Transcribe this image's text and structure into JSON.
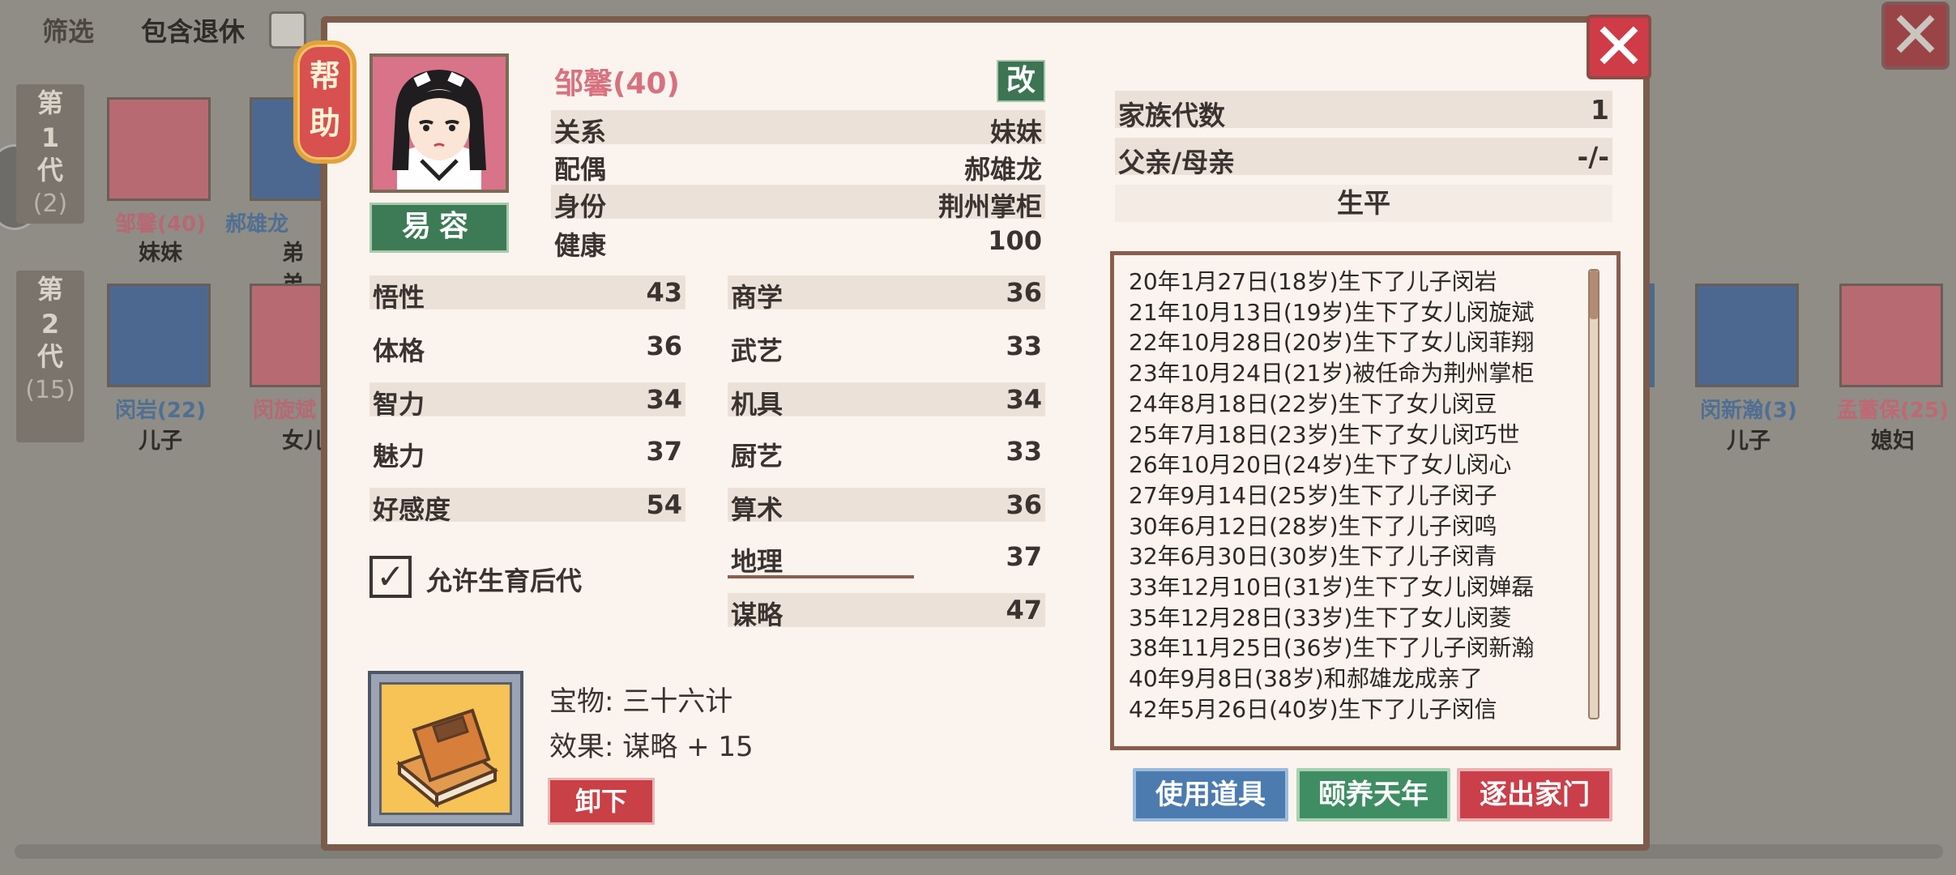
{
  "background": {
    "filter_label": "筛选",
    "include_retired_label": "包含退休",
    "generations": [
      {
        "label": "第\n1\n代",
        "line1": "第",
        "line2": "1",
        "line3": "代",
        "count": "(2)"
      },
      {
        "label": "第\n2\n代",
        "line1": "第",
        "line2": "2",
        "line3": "代",
        "count": "(15)"
      }
    ],
    "members_row1": [
      {
        "name": "邹馨(40)",
        "relation": "妹妹",
        "color": "#c06873"
      },
      {
        "name": "郝雄龙",
        "relation": "弟弟",
        "color": "#4f6f93"
      }
    ],
    "members_row2": [
      {
        "name": "闵岩(22)",
        "relation": "儿子",
        "color": "#4f6f93"
      },
      {
        "name": "闵旋斌",
        "relation": "女儿",
        "color": "#c06873"
      },
      {
        "name": "闵新瀚(3)",
        "relation": "儿子",
        "color": "#4f6f93"
      },
      {
        "name": "孟蓄保(25)",
        "relation": "媳妇",
        "color": "#c06873"
      }
    ]
  },
  "dialog": {
    "help_label_1": "帮",
    "help_label_2": "助",
    "close_icon": "close-icon",
    "name": "邹馨(40)",
    "edit_label": "改",
    "disguise_label": "易容",
    "info": [
      {
        "key": "关系",
        "value": "妹妹"
      },
      {
        "key": "配偶",
        "value": "郝雄龙"
      },
      {
        "key": "身份",
        "value": "荆州掌柜"
      },
      {
        "key": "健康",
        "value": "100"
      }
    ],
    "stats_left": [
      {
        "key": "悟性",
        "value": "43"
      },
      {
        "key": "体格",
        "value": "36"
      },
      {
        "key": "智力",
        "value": "34"
      },
      {
        "key": "魅力",
        "value": "37"
      },
      {
        "key": "好感度",
        "value": "54"
      }
    ],
    "stats_right": [
      {
        "key": "商学",
        "value": "36"
      },
      {
        "key": "武艺",
        "value": "33"
      },
      {
        "key": "机具",
        "value": "34"
      },
      {
        "key": "厨艺",
        "value": "33"
      },
      {
        "key": "算术",
        "value": "36"
      },
      {
        "key": "地理",
        "value": "37"
      },
      {
        "key": "谋略",
        "value": "47"
      }
    ],
    "allow_offspring_label": "允许生育后代",
    "allow_offspring_checked": true,
    "treasure_name": "宝物: 三十六计",
    "treasure_effect": "效果: 谋略 + 15",
    "unequip_label": "卸下",
    "family_info": [
      {
        "key": "家族代数",
        "value": "1"
      },
      {
        "key": "父亲/母亲",
        "value": "-/-"
      }
    ],
    "biography_title": "生平",
    "biography": [
      "20年1月27日(18岁)生下了儿子闵岩",
      "21年10月13日(19岁)生下了女儿闵旋斌",
      "22年10月28日(20岁)生下了女儿闵菲翔",
      "23年10月24日(21岁)被任命为荆州掌柜",
      "24年8月18日(22岁)生下了女儿闵豆",
      "25年7月18日(23岁)生下了女儿闵巧世",
      "26年10月20日(24岁)生下了女儿闵心",
      "27年9月14日(25岁)生下了儿子闵子",
      "30年6月12日(28岁)生下了儿子闵鸣",
      "32年6月30日(30岁)生下了儿子闵青",
      "33年12月10日(31岁)生下了女儿闵婵磊",
      "35年12月28日(33岁)生下了女儿闵菱",
      "38年11月25日(36岁)生下了儿子闵新瀚",
      "40年9月8日(38岁)和郝雄龙成亲了",
      "42年5月26日(40岁)生下了儿子闵信"
    ],
    "actions": {
      "use_item": "使用道具",
      "retire": "颐养天年",
      "expel": "逐出家门"
    },
    "colors": {
      "name_pink": "#d8717f",
      "green_button": "#3d7a56",
      "red_button": "#ca3f49",
      "blue_button": "#4c7bb0",
      "border_brown": "#7c5b4b"
    }
  }
}
